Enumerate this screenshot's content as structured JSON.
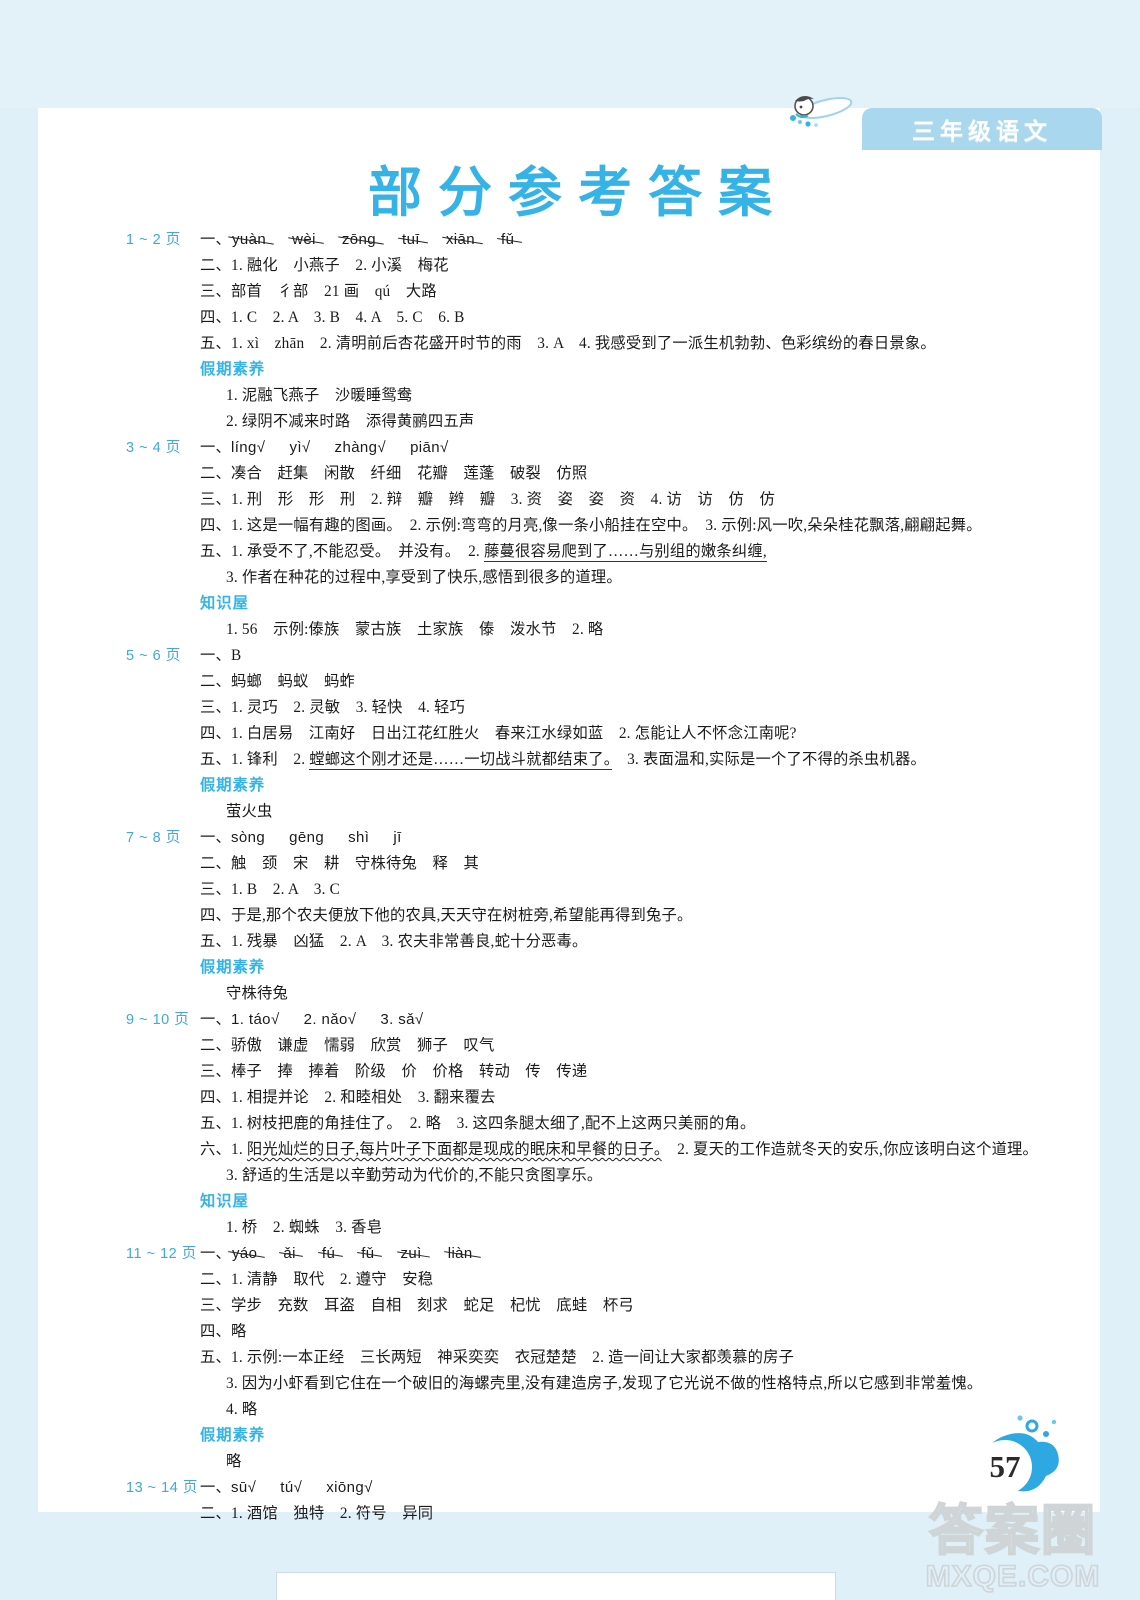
{
  "header": {
    "grade_tab": "三年级语文",
    "swimmer_icon": "swimming-child-icon",
    "accent_color": "#35b3e7",
    "tab_color": "#a9d8ee"
  },
  "title": "部分参考答案",
  "sections": [
    {
      "pages": "1 ~ 2 页",
      "lines": [
        {
          "type": "pinyin-strike",
          "prefix": "一、",
          "items": [
            "yuàn",
            "wèi",
            "zōng",
            "tuī",
            "xiān",
            "fǔ"
          ]
        },
        {
          "type": "text",
          "text": "二、1. 融化　小燕子　2. 小溪　梅花"
        },
        {
          "type": "text",
          "text": "三、部首　彳部　21 画　qú　大路"
        },
        {
          "type": "text",
          "text": "四、1. C　2. A　3. B　4. A　5. C　6. B"
        },
        {
          "type": "text",
          "text": "五、1. xì　zhān　2. 清明前后杏花盛开时节的雨　3. A　4. 我感受到了一派生机勃勃、色彩缤纷的春日景象。"
        },
        {
          "type": "subhead",
          "text": "假期素养"
        },
        {
          "type": "indent",
          "text": "1. 泥融飞燕子　沙暖睡鸳鸯"
        },
        {
          "type": "indent",
          "text": "2. 绿阴不减来时路　添得黄鹂四五声"
        }
      ]
    },
    {
      "pages": "3 ~ 4 页",
      "lines": [
        {
          "type": "pinyin-tick",
          "prefix": "一、",
          "items": [
            "líng",
            "yì",
            "zhàng",
            "piān"
          ]
        },
        {
          "type": "text",
          "text": "二、凑合　赶集　闲散　纤细　花瓣　莲蓬　破裂　仿照"
        },
        {
          "type": "text",
          "text": "三、1. 刑　形　形　刑　2. 辩　瓣　辫　瓣　3. 资　姿　姿　资　4. 访　访　仿　仿"
        },
        {
          "type": "text",
          "text": "四、1. 这是一幅有趣的图画。　2. 示例:弯弯的月亮,像一条小船挂在空中。　3. 示例:风一吹,朵朵桂花飘落,翩翩起舞。"
        },
        {
          "type": "underline-part",
          "before": "五、1. 承受不了,不能忍受。　并没有。　2. ",
          "underlined": "藤蔓很容易爬到了……与别组的嫩条纠缠,"
        },
        {
          "type": "indent",
          "text": "3. 作者在种花的过程中,享受到了快乐,感悟到很多的道理。"
        },
        {
          "type": "subhead",
          "text": "知识屋"
        },
        {
          "type": "indent",
          "text": "1. 56　示例:傣族　蒙古族　土家族　傣　泼水节　2. 略"
        }
      ]
    },
    {
      "pages": "5 ~ 6 页",
      "lines": [
        {
          "type": "text",
          "text": "一、B"
        },
        {
          "type": "text",
          "text": "二、蚂螂　蚂蚁　蚂蚱"
        },
        {
          "type": "text",
          "text": "三、1. 灵巧　2. 灵敏　3. 轻快　4. 轻巧"
        },
        {
          "type": "text",
          "text": "四、1. 白居易　江南好　日出江花红胜火　春来江水绿如蓝　2. 怎能让人不怀念江南呢?"
        },
        {
          "type": "underline-mid",
          "before": "五、1. 锋利　2. ",
          "underlined": "螳螂这个刚才还是……一切战斗就都结束了。",
          "after": "　3. 表面温和,实际是一个了不得的杀虫机器。"
        },
        {
          "type": "subhead",
          "text": "假期素养"
        },
        {
          "type": "indent",
          "text": "萤火虫"
        }
      ]
    },
    {
      "pages": "7 ~ 8 页",
      "lines": [
        {
          "type": "pinyin-plain",
          "prefix": "一、",
          "items": [
            "sòng",
            "gēng",
            "shì",
            "jī"
          ]
        },
        {
          "type": "text",
          "text": "二、触　颈　宋　耕　守株待兔　释　其"
        },
        {
          "type": "text",
          "text": "三、1. B　2. A　3. C"
        },
        {
          "type": "text",
          "text": "四、于是,那个农夫便放下他的农具,天天守在树桩旁,希望能再得到兔子。"
        },
        {
          "type": "text",
          "text": "五、1. 残暴　凶猛　2. A　3. 农夫非常善良,蛇十分恶毒。"
        },
        {
          "type": "subhead",
          "text": "假期素养"
        },
        {
          "type": "indent",
          "text": "守株待兔"
        }
      ]
    },
    {
      "pages": "9 ~ 10 页",
      "lines": [
        {
          "type": "pinyin-tick-num",
          "prefix": "一、",
          "items": [
            "1. táo",
            "2. nǎo",
            "3. sǎ"
          ]
        },
        {
          "type": "text",
          "text": "二、骄傲　谦虚　懦弱　欣赏　狮子　叹气"
        },
        {
          "type": "text",
          "text": "三、棒子　捧　捧着　阶级　价　价格　转动　传　传递"
        },
        {
          "type": "text",
          "text": "四、1. 相提并论　2. 和睦相处　3. 翻来覆去"
        },
        {
          "type": "text",
          "text": "五、1. 树枝把鹿的角挂住了。　2. 略　3. 这四条腿太细了,配不上这两只美丽的角。"
        },
        {
          "type": "wavy-part",
          "before": "六、1. ",
          "wavy": "阳光灿烂的日子,每片叶子下面都是现成的眠床和早餐的日子。",
          "after": "　2. 夏天的工作造就冬天的安乐,你应该明白这个道理。"
        },
        {
          "type": "indent",
          "text": "3. 舒适的生活是以辛勤劳动为代价的,不能只贪图享乐。"
        },
        {
          "type": "subhead",
          "text": "知识屋"
        },
        {
          "type": "indent",
          "text": "1. 桥　2. 蜘蛛　3. 香皂"
        }
      ]
    },
    {
      "pages": "11 ~ 12 页",
      "lines": [
        {
          "type": "pinyin-strike",
          "prefix": "一、",
          "items": [
            "yáo",
            "ǎi",
            "fú",
            "fǔ",
            "zuì",
            "liàn"
          ]
        },
        {
          "type": "text",
          "text": "二、1. 清静　取代　2. 遵守　安稳"
        },
        {
          "type": "text",
          "text": "三、学步　充数　耳盗　自相　刻求　蛇足　杞忧　底蛙　杯弓"
        },
        {
          "type": "text",
          "text": "四、略"
        },
        {
          "type": "text",
          "text": "五、1. 示例:一本正经　三长两短　神采奕奕　衣冠楚楚　2. 造一间让大家都羡慕的房子"
        },
        {
          "type": "indent",
          "text": "3. 因为小虾看到它住在一个破旧的海螺壳里,没有建造房子,发现了它光说不做的性格特点,所以它感到非常羞愧。"
        },
        {
          "type": "indent",
          "text": "4. 略"
        },
        {
          "type": "subhead",
          "text": "假期素养"
        },
        {
          "type": "indent",
          "text": "略"
        }
      ]
    },
    {
      "pages": "13 ~ 14 页",
      "lines": [
        {
          "type": "pinyin-tick",
          "prefix": "一、",
          "items": [
            "sū",
            "tú",
            "xiōng"
          ]
        },
        {
          "type": "text",
          "text": "二、1. 酒馆　独特　2. 符号　异同"
        }
      ]
    }
  ],
  "footer": {
    "page_number": "57",
    "watermark_cn": "答案圈",
    "watermark_en": "MXQE.COM"
  }
}
